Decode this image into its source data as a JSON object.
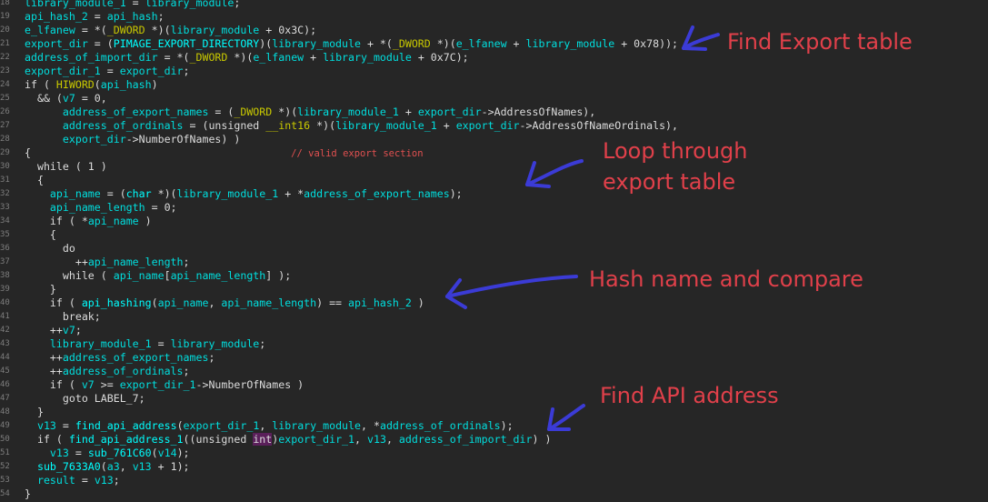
{
  "code": {
    "lines": [
      {
        "n": "18",
        "segs": [
          [
            "var",
            "library_module_1"
          ],
          [
            "plain",
            " = "
          ],
          [
            "var",
            "library_module"
          ],
          [
            "plain",
            ";"
          ]
        ]
      },
      {
        "n": "19",
        "segs": [
          [
            "var",
            "api_hash_2"
          ],
          [
            "plain",
            " = "
          ],
          [
            "var",
            "api_hash"
          ],
          [
            "plain",
            ";"
          ]
        ]
      },
      {
        "n": "20",
        "segs": [
          [
            "var",
            "e_lfanew"
          ],
          [
            "plain",
            " = *("
          ],
          [
            "macro",
            "_DWORD"
          ],
          [
            "plain",
            " *)("
          ],
          [
            "var",
            "library_module"
          ],
          [
            "plain",
            " + 0x3C);"
          ]
        ]
      },
      {
        "n": "21",
        "segs": [
          [
            "var",
            "export_dir"
          ],
          [
            "plain",
            " = ("
          ],
          [
            "type",
            "PIMAGE_EXPORT_DIRECTORY"
          ],
          [
            "plain",
            ")("
          ],
          [
            "var",
            "library_module"
          ],
          [
            "plain",
            " + *("
          ],
          [
            "macro",
            "_DWORD"
          ],
          [
            "plain",
            " *)("
          ],
          [
            "var",
            "e_lfanew"
          ],
          [
            "plain",
            " + "
          ],
          [
            "var",
            "library_module"
          ],
          [
            "plain",
            " + 0x78));"
          ]
        ]
      },
      {
        "n": "22",
        "segs": [
          [
            "var",
            "address_of_import_dir"
          ],
          [
            "plain",
            " = *("
          ],
          [
            "macro",
            "_DWORD"
          ],
          [
            "plain",
            " *)("
          ],
          [
            "var",
            "e_lfanew"
          ],
          [
            "plain",
            " + "
          ],
          [
            "var",
            "library_module"
          ],
          [
            "plain",
            " + 0x7C);"
          ]
        ]
      },
      {
        "n": "23",
        "segs": [
          [
            "var",
            "export_dir_1"
          ],
          [
            "plain",
            " = "
          ],
          [
            "var",
            "export_dir"
          ],
          [
            "plain",
            ";"
          ]
        ]
      },
      {
        "n": "24",
        "segs": [
          [
            "plain",
            "if ( "
          ],
          [
            "macro",
            "HIWORD"
          ],
          [
            "plain",
            "("
          ],
          [
            "var",
            "api_hash"
          ],
          [
            "plain",
            ")"
          ]
        ]
      },
      {
        "n": "25",
        "segs": [
          [
            "plain",
            "  && ("
          ],
          [
            "var",
            "v7"
          ],
          [
            "plain",
            " = 0,"
          ]
        ]
      },
      {
        "n": "26",
        "segs": [
          [
            "plain",
            "      "
          ],
          [
            "var",
            "address_of_export_names"
          ],
          [
            "plain",
            " = ("
          ],
          [
            "macro",
            "_DWORD"
          ],
          [
            "plain",
            " *)("
          ],
          [
            "var",
            "library_module_1"
          ],
          [
            "plain",
            " + "
          ],
          [
            "var",
            "export_dir"
          ],
          [
            "plain",
            "->AddressOfNames),"
          ]
        ]
      },
      {
        "n": "27",
        "segs": [
          [
            "plain",
            "      "
          ],
          [
            "var",
            "address_of_ordinals"
          ],
          [
            "plain",
            " = ("
          ],
          [
            "kw",
            "unsigned"
          ],
          [
            "plain",
            " "
          ],
          [
            "macro",
            "__int16"
          ],
          [
            "plain",
            " *)("
          ],
          [
            "var",
            "library_module_1"
          ],
          [
            "plain",
            " + "
          ],
          [
            "var",
            "export_dir"
          ],
          [
            "plain",
            "->AddressOfNameOrdinals),"
          ]
        ]
      },
      {
        "n": "28",
        "segs": [
          [
            "plain",
            "      "
          ],
          [
            "var",
            "export_dir"
          ],
          [
            "plain",
            "->NumberOfNames) )"
          ]
        ]
      },
      {
        "n": "29",
        "segs": [
          [
            "plain",
            "{                                         "
          ],
          [
            "comment",
            "// valid export section"
          ]
        ]
      },
      {
        "n": "30",
        "segs": [
          [
            "plain",
            "  while ( 1 )"
          ]
        ]
      },
      {
        "n": "31",
        "segs": [
          [
            "plain",
            "  {"
          ]
        ]
      },
      {
        "n": "32",
        "segs": [
          [
            "plain",
            "    "
          ],
          [
            "var",
            "api_name"
          ],
          [
            "plain",
            " = ("
          ],
          [
            "type",
            "char"
          ],
          [
            "plain",
            " *)("
          ],
          [
            "var",
            "library_module_1"
          ],
          [
            "plain",
            " + *"
          ],
          [
            "var",
            "address_of_export_names"
          ],
          [
            "plain",
            ");"
          ]
        ]
      },
      {
        "n": "33",
        "segs": [
          [
            "plain",
            "    "
          ],
          [
            "var",
            "api_name_length"
          ],
          [
            "plain",
            " = 0;"
          ]
        ]
      },
      {
        "n": "34",
        "segs": [
          [
            "plain",
            "    if ( *"
          ],
          [
            "var",
            "api_name"
          ],
          [
            "plain",
            " )"
          ]
        ]
      },
      {
        "n": "35",
        "segs": [
          [
            "plain",
            "    {"
          ]
        ]
      },
      {
        "n": "36",
        "segs": [
          [
            "plain",
            "      do"
          ]
        ]
      },
      {
        "n": "37",
        "segs": [
          [
            "plain",
            "        ++"
          ],
          [
            "var",
            "api_name_length"
          ],
          [
            "plain",
            ";"
          ]
        ]
      },
      {
        "n": "38",
        "segs": [
          [
            "plain",
            "      while ( "
          ],
          [
            "var",
            "api_name"
          ],
          [
            "plain",
            "["
          ],
          [
            "var",
            "api_name_length"
          ],
          [
            "plain",
            "] );"
          ]
        ]
      },
      {
        "n": "39",
        "segs": [
          [
            "plain",
            "    }"
          ]
        ]
      },
      {
        "n": "40",
        "segs": [
          [
            "plain",
            "    if ( "
          ],
          [
            "fn",
            "api_hashing"
          ],
          [
            "plain",
            "("
          ],
          [
            "var",
            "api_name"
          ],
          [
            "plain",
            ", "
          ],
          [
            "var",
            "api_name_length"
          ],
          [
            "plain",
            ") == "
          ],
          [
            "var",
            "api_hash_2"
          ],
          [
            "plain",
            " )"
          ]
        ]
      },
      {
        "n": "41",
        "segs": [
          [
            "plain",
            "      break;"
          ]
        ]
      },
      {
        "n": "42",
        "segs": [
          [
            "plain",
            "    ++"
          ],
          [
            "var",
            "v7"
          ],
          [
            "plain",
            ";"
          ]
        ]
      },
      {
        "n": "43",
        "segs": [
          [
            "plain",
            "    "
          ],
          [
            "var",
            "library_module_1"
          ],
          [
            "plain",
            " = "
          ],
          [
            "var",
            "library_module"
          ],
          [
            "plain",
            ";"
          ]
        ]
      },
      {
        "n": "44",
        "segs": [
          [
            "plain",
            "    ++"
          ],
          [
            "var",
            "address_of_export_names"
          ],
          [
            "plain",
            ";"
          ]
        ]
      },
      {
        "n": "45",
        "segs": [
          [
            "plain",
            "    ++"
          ],
          [
            "var",
            "address_of_ordinals"
          ],
          [
            "plain",
            ";"
          ]
        ]
      },
      {
        "n": "46",
        "segs": [
          [
            "plain",
            "    if ( "
          ],
          [
            "var",
            "v7"
          ],
          [
            "plain",
            " >= "
          ],
          [
            "var",
            "export_dir_1"
          ],
          [
            "plain",
            "->NumberOfNames )"
          ]
        ]
      },
      {
        "n": "47",
        "segs": [
          [
            "plain",
            "      goto LABEL_7;"
          ]
        ]
      },
      {
        "n": "48",
        "segs": [
          [
            "plain",
            "  }"
          ]
        ]
      },
      {
        "n": "49",
        "segs": [
          [
            "plain",
            "  "
          ],
          [
            "var",
            "v13"
          ],
          [
            "plain",
            " = "
          ],
          [
            "fn",
            "find_api_address"
          ],
          [
            "plain",
            "("
          ],
          [
            "var",
            "export_dir_1"
          ],
          [
            "plain",
            ", "
          ],
          [
            "var",
            "library_module"
          ],
          [
            "plain",
            ", *"
          ],
          [
            "var",
            "address_of_ordinals"
          ],
          [
            "plain",
            ");"
          ]
        ]
      },
      {
        "n": "50",
        "segs": [
          [
            "plain",
            "  if ( "
          ],
          [
            "fn",
            "find_api_address_1"
          ],
          [
            "plain",
            "(("
          ],
          [
            "kw",
            "unsigned"
          ],
          [
            "plain",
            " "
          ],
          [
            "hl",
            "int"
          ],
          [
            "plain",
            ")"
          ],
          [
            "var",
            "export_dir_1"
          ],
          [
            "plain",
            ", "
          ],
          [
            "var",
            "v13"
          ],
          [
            "plain",
            ", "
          ],
          [
            "var",
            "address_of_import_dir"
          ],
          [
            "plain",
            ") )"
          ]
        ]
      },
      {
        "n": "51",
        "segs": [
          [
            "plain",
            "    "
          ],
          [
            "var",
            "v13"
          ],
          [
            "plain",
            " = "
          ],
          [
            "fn",
            "sub_761C60"
          ],
          [
            "plain",
            "("
          ],
          [
            "var",
            "v14"
          ],
          [
            "plain",
            ");"
          ]
        ]
      },
      {
        "n": "52",
        "segs": [
          [
            "plain",
            "  "
          ],
          [
            "fn",
            "sub_7633A0"
          ],
          [
            "plain",
            "("
          ],
          [
            "var",
            "a3"
          ],
          [
            "plain",
            ", "
          ],
          [
            "var",
            "v13"
          ],
          [
            "plain",
            " + 1);"
          ]
        ]
      },
      {
        "n": "53",
        "segs": [
          [
            "plain",
            "  "
          ],
          [
            "var",
            "result"
          ],
          [
            "plain",
            " = "
          ],
          [
            "var",
            "v13"
          ],
          [
            "plain",
            ";"
          ]
        ]
      },
      {
        "n": "54",
        "segs": [
          [
            "plain",
            "}"
          ]
        ]
      }
    ]
  },
  "annotations": [
    {
      "id": "find-export-table",
      "text": "Find Export table"
    },
    {
      "id": "loop-export-table",
      "text": "Loop through\nexport table"
    },
    {
      "id": "hash-name-compare",
      "text": "Hash name and compare"
    },
    {
      "id": "find-api-address",
      "text": "Find API address"
    }
  ],
  "colors": {
    "background": "#262626",
    "annotation_red": "#e0404a",
    "arrow_blue": "#3b3bd6",
    "variable": "#00dede",
    "macro": "#c8c800",
    "comment": "#e05050"
  }
}
